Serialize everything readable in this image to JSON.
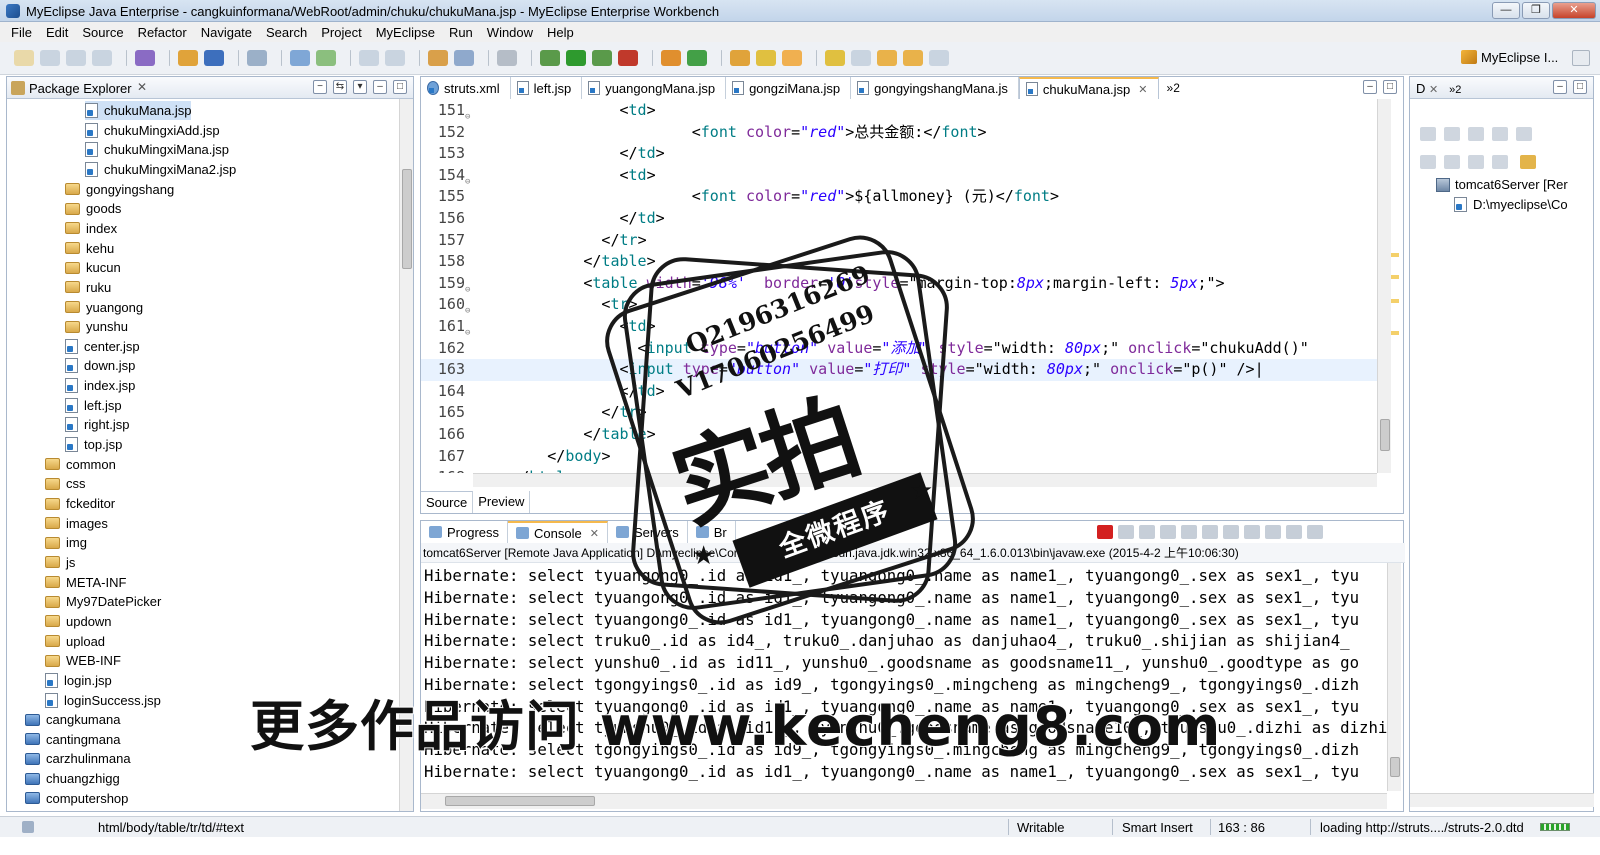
{
  "window": {
    "title": "MyEclipse Java Enterprise - cangkuinformana/WebRoot/admin/chuku/chukuMana.jsp - MyEclipse Enterprise Workbench",
    "buttons": [
      "—",
      "❐",
      "✕"
    ]
  },
  "menu": [
    "File",
    "Edit",
    "Source",
    "Refactor",
    "Navigate",
    "Search",
    "Project",
    "MyEclipse",
    "Run",
    "Window",
    "Help"
  ],
  "toolbar": {
    "perspective_label": "MyEclipse I..."
  },
  "package_explorer": {
    "title": "Package Explorer",
    "close": "✕",
    "items": [
      {
        "label": "chukuMana.jsp",
        "type": "jsp",
        "indent": 3,
        "selected": true
      },
      {
        "label": "chukuMingxiAdd.jsp",
        "type": "jsp",
        "indent": 3
      },
      {
        "label": "chukuMingxiMana.jsp",
        "type": "jsp",
        "indent": 3
      },
      {
        "label": "chukuMingxiMana2.jsp",
        "type": "jsp",
        "indent": 3
      },
      {
        "label": "gongyingshang",
        "type": "folder",
        "indent": 2
      },
      {
        "label": "goods",
        "type": "folder",
        "indent": 2
      },
      {
        "label": "index",
        "type": "folder",
        "indent": 2
      },
      {
        "label": "kehu",
        "type": "folder",
        "indent": 2
      },
      {
        "label": "kucun",
        "type": "folder",
        "indent": 2
      },
      {
        "label": "ruku",
        "type": "folder",
        "indent": 2
      },
      {
        "label": "yuangong",
        "type": "folder",
        "indent": 2
      },
      {
        "label": "yunshu",
        "type": "folder",
        "indent": 2
      },
      {
        "label": "center.jsp",
        "type": "jsp",
        "indent": 2
      },
      {
        "label": "down.jsp",
        "type": "jsp",
        "indent": 2
      },
      {
        "label": "index.jsp",
        "type": "jsp",
        "indent": 2
      },
      {
        "label": "left.jsp",
        "type": "jsp",
        "indent": 2
      },
      {
        "label": "right.jsp",
        "type": "jsp",
        "indent": 2
      },
      {
        "label": "top.jsp",
        "type": "jsp",
        "indent": 2
      },
      {
        "label": "common",
        "type": "folder",
        "indent": 1
      },
      {
        "label": "css",
        "type": "folder",
        "indent": 1
      },
      {
        "label": "fckeditor",
        "type": "folder",
        "indent": 1
      },
      {
        "label": "images",
        "type": "folder",
        "indent": 1
      },
      {
        "label": "img",
        "type": "folder",
        "indent": 1
      },
      {
        "label": "js",
        "type": "folder",
        "indent": 1
      },
      {
        "label": "META-INF",
        "type": "folder",
        "indent": 1
      },
      {
        "label": "My97DatePicker",
        "type": "folder",
        "indent": 1
      },
      {
        "label": "updown",
        "type": "folder",
        "indent": 1
      },
      {
        "label": "upload",
        "type": "folder",
        "indent": 1
      },
      {
        "label": "WEB-INF",
        "type": "folder",
        "indent": 1
      },
      {
        "label": "login.jsp",
        "type": "jsp",
        "indent": 1
      },
      {
        "label": "loginSuccess.jsp",
        "type": "jsp",
        "indent": 1
      },
      {
        "label": "cangkumana",
        "type": "project",
        "indent": 0
      },
      {
        "label": "cantingmana",
        "type": "project",
        "indent": 0
      },
      {
        "label": "carzhulinmana",
        "type": "project",
        "indent": 0
      },
      {
        "label": "chuangzhigg",
        "type": "project",
        "indent": 0
      },
      {
        "label": "computershop",
        "type": "project",
        "indent": 0
      }
    ]
  },
  "editor": {
    "tabs": [
      {
        "label": "struts.xml",
        "icon": "gear"
      },
      {
        "label": "left.jsp",
        "icon": "jsp"
      },
      {
        "label": "yuangongMana.jsp",
        "icon": "jsp"
      },
      {
        "label": "gongziMana.jsp",
        "icon": "jsp"
      },
      {
        "label": "gongyingshangMana.js",
        "icon": "jsp"
      },
      {
        "label": "chukuMana.jsp",
        "icon": "jsp",
        "active": true
      }
    ],
    "overflow": "»2",
    "current_line": 163,
    "lines": [
      {
        "no": "151",
        "fold": true,
        "segs": [
          [
            "t",
            "                <"
          ],
          [
            "tag",
            "td"
          ],
          [
            "t",
            ">"
          ]
        ]
      },
      {
        "no": "152",
        "segs": [
          [
            "t",
            "                        <"
          ],
          [
            "tag",
            "font"
          ],
          [
            "t",
            " "
          ],
          [
            "attr",
            "color"
          ],
          [
            "t",
            "="
          ],
          [
            "str",
            "\"red\""
          ],
          [
            "t",
            ">总共金额:</"
          ],
          [
            "tag",
            "font"
          ],
          [
            "t",
            ">"
          ]
        ]
      },
      {
        "no": "153",
        "segs": [
          [
            "t",
            "                </"
          ],
          [
            "tag",
            "td"
          ],
          [
            "t",
            ">"
          ]
        ]
      },
      {
        "no": "154",
        "fold": true,
        "segs": [
          [
            "t",
            "                <"
          ],
          [
            "tag",
            "td"
          ],
          [
            "t",
            ">"
          ]
        ]
      },
      {
        "no": "155",
        "segs": [
          [
            "t",
            "                        <"
          ],
          [
            "tag",
            "font"
          ],
          [
            "t",
            " "
          ],
          [
            "attr",
            "color"
          ],
          [
            "t",
            "="
          ],
          [
            "str",
            "\"red\""
          ],
          [
            "t",
            ">${allmoney} (元)</"
          ],
          [
            "tag",
            "font"
          ],
          [
            "t",
            ">"
          ]
        ]
      },
      {
        "no": "156",
        "segs": [
          [
            "t",
            "                </"
          ],
          [
            "tag",
            "td"
          ],
          [
            "t",
            ">"
          ]
        ]
      },
      {
        "no": "157",
        "segs": [
          [
            "t",
            "              </"
          ],
          [
            "tag",
            "tr"
          ],
          [
            "t",
            ">"
          ]
        ]
      },
      {
        "no": "158",
        "segs": [
          [
            "t",
            "            </"
          ],
          [
            "tag",
            "table"
          ],
          [
            "t",
            ">"
          ]
        ]
      },
      {
        "no": "159",
        "fold": true,
        "segs": [
          [
            "t",
            "            <"
          ],
          [
            "tag",
            "table"
          ],
          [
            "t",
            " "
          ],
          [
            "attr",
            "width"
          ],
          [
            "t",
            "="
          ],
          [
            "str",
            "'98%'"
          ],
          [
            "t",
            "  "
          ],
          [
            "attr",
            "border"
          ],
          [
            "t",
            "="
          ],
          [
            "str",
            "'0'"
          ],
          [
            "attr",
            "style"
          ],
          [
            "t",
            "=\"margin-top:"
          ],
          [
            "str",
            "8px"
          ],
          [
            "t",
            ";margin-left: "
          ],
          [
            "str",
            "5px"
          ],
          [
            "t",
            ";\">"
          ]
        ]
      },
      {
        "no": "160",
        "fold": true,
        "segs": [
          [
            "t",
            "              <"
          ],
          [
            "tag",
            "tr"
          ],
          [
            "t",
            ">"
          ]
        ]
      },
      {
        "no": "161",
        "fold": true,
        "segs": [
          [
            "t",
            "                <"
          ],
          [
            "tag",
            "td"
          ],
          [
            "t",
            ">"
          ]
        ]
      },
      {
        "no": "162",
        "segs": [
          [
            "t",
            "                  <"
          ],
          [
            "tag",
            "input"
          ],
          [
            "t",
            " "
          ],
          [
            "attr",
            "type"
          ],
          [
            "t",
            "="
          ],
          [
            "str",
            "\"button\""
          ],
          [
            "t",
            " "
          ],
          [
            "attr",
            "value"
          ],
          [
            "t",
            "="
          ],
          [
            "str",
            "\"添加\""
          ],
          [
            "t",
            " "
          ],
          [
            "attr",
            "style"
          ],
          [
            "t",
            "=\"width: "
          ],
          [
            "str",
            "80px"
          ],
          [
            "t",
            ";\" "
          ],
          [
            "attr",
            "onclick"
          ],
          [
            "t",
            "=\"chukuAdd()\""
          ]
        ]
      },
      {
        "no": "163",
        "segs": [
          [
            "t",
            "                <"
          ],
          [
            "tag",
            "input"
          ],
          [
            "t",
            " "
          ],
          [
            "attr",
            "type"
          ],
          [
            "t",
            "="
          ],
          [
            "str",
            "\"button\""
          ],
          [
            "t",
            " "
          ],
          [
            "attr",
            "value"
          ],
          [
            "t",
            "="
          ],
          [
            "str",
            "\"打印\""
          ],
          [
            "t",
            " "
          ],
          [
            "attr",
            "style"
          ],
          [
            "t",
            "=\"width: "
          ],
          [
            "str",
            "80px"
          ],
          [
            "t",
            ";\" "
          ],
          [
            "attr",
            "onclick"
          ],
          [
            "t",
            "=\"p()\" />|"
          ]
        ]
      },
      {
        "no": "164",
        "segs": [
          [
            "t",
            "                </"
          ],
          [
            "tag",
            "td"
          ],
          [
            "t",
            ">"
          ]
        ]
      },
      {
        "no": "165",
        "segs": [
          [
            "t",
            "              </"
          ],
          [
            "tag",
            "tr"
          ],
          [
            "t",
            ">"
          ]
        ]
      },
      {
        "no": "166",
        "segs": [
          [
            "t",
            "            </"
          ],
          [
            "tag",
            "table"
          ],
          [
            "t",
            ">"
          ]
        ]
      },
      {
        "no": "167",
        "segs": [
          [
            "t",
            "        </"
          ],
          [
            "tag",
            "body"
          ],
          [
            "t",
            ">"
          ]
        ]
      },
      {
        "no": "168",
        "segs": [
          [
            "t",
            "    </"
          ],
          [
            "tag",
            "html"
          ],
          [
            "t",
            ">"
          ]
        ]
      }
    ],
    "bottom_tabs": [
      "Source",
      "Preview"
    ]
  },
  "outline": {
    "tabs": [
      "D",
      "»2"
    ],
    "items": [
      {
        "label": "tomcat6Server [Rer",
        "indent": 1
      },
      {
        "label": "D:\\myeclipse\\Co",
        "indent": 2
      }
    ]
  },
  "console": {
    "tabs": [
      "Progress",
      "Console",
      "Servers",
      "Br"
    ],
    "description": "tomcat6Server [Remote Java Application] D:\\myeclipse\\Common\\binary\\com.sun.java.jdk.win32.x86_64_1.6.0.013\\bin\\javaw.exe (2015-4-2 上午10:06:30)",
    "lines": [
      "Hibernate: select tyuangong0_.id as id1_, tyuangong0_.name as name1_, tyuangong0_.sex as sex1_, tyu",
      "Hibernate: select tyuangong0_.id as id1_, tyuangong0_.name as name1_, tyuangong0_.sex as sex1_, tyu",
      "Hibernate: select tyuangong0_.id as id1_, tyuangong0_.name as name1_, tyuangong0_.sex as sex1_, tyu",
      "Hibernate: select truku0_.id as id4_, truku0_.danjuhao as danjuhao4_, truku0_.shijian as shijian4_",
      "Hibernate: select yunshu0_.id as id11_, yunshu0_.goodsname as goodsname11_, yunshu0_.goodtype as go",
      "Hibernate: select tgongyings0_.id as id9_, tgongyings0_.mingcheng as mingcheng9_, tgongyings0_.dizh",
      "Hibernate: select tyuangong0_.id as id1_, tyuangong0_.name as name1_, tyuangong0_.sex as sex1_, tyu",
      "Hibernate: select tyunshu0_.id as id10_, tyunshu0_.goodsname as goodsname10_, tyunshu0_.dizhi as dizhi10_",
      "Hibernate: select tgongyings0_.id as id9_, tgongyings0_.mingcheng as mingcheng9_, tgongyings0_.dizh",
      "Hibernate: select tyuangong0_.id as id1_, tyuangong0_.name as name1_, tyuangong0_.sex as sex1_, tyu"
    ]
  },
  "status": {
    "path": "html/body/table/tr/td/#text",
    "mode": "Writable",
    "insert": "Smart Insert",
    "position": "163 : 86",
    "loading": "loading http://struts..../struts-2.0.dtd"
  },
  "watermark": {
    "qq": "Q2196316269",
    "vx": "V17060256499",
    "big": "实拍",
    "ribbon": "全微程序",
    "bottom": "更多作品访问 www.kecheng8.com"
  }
}
